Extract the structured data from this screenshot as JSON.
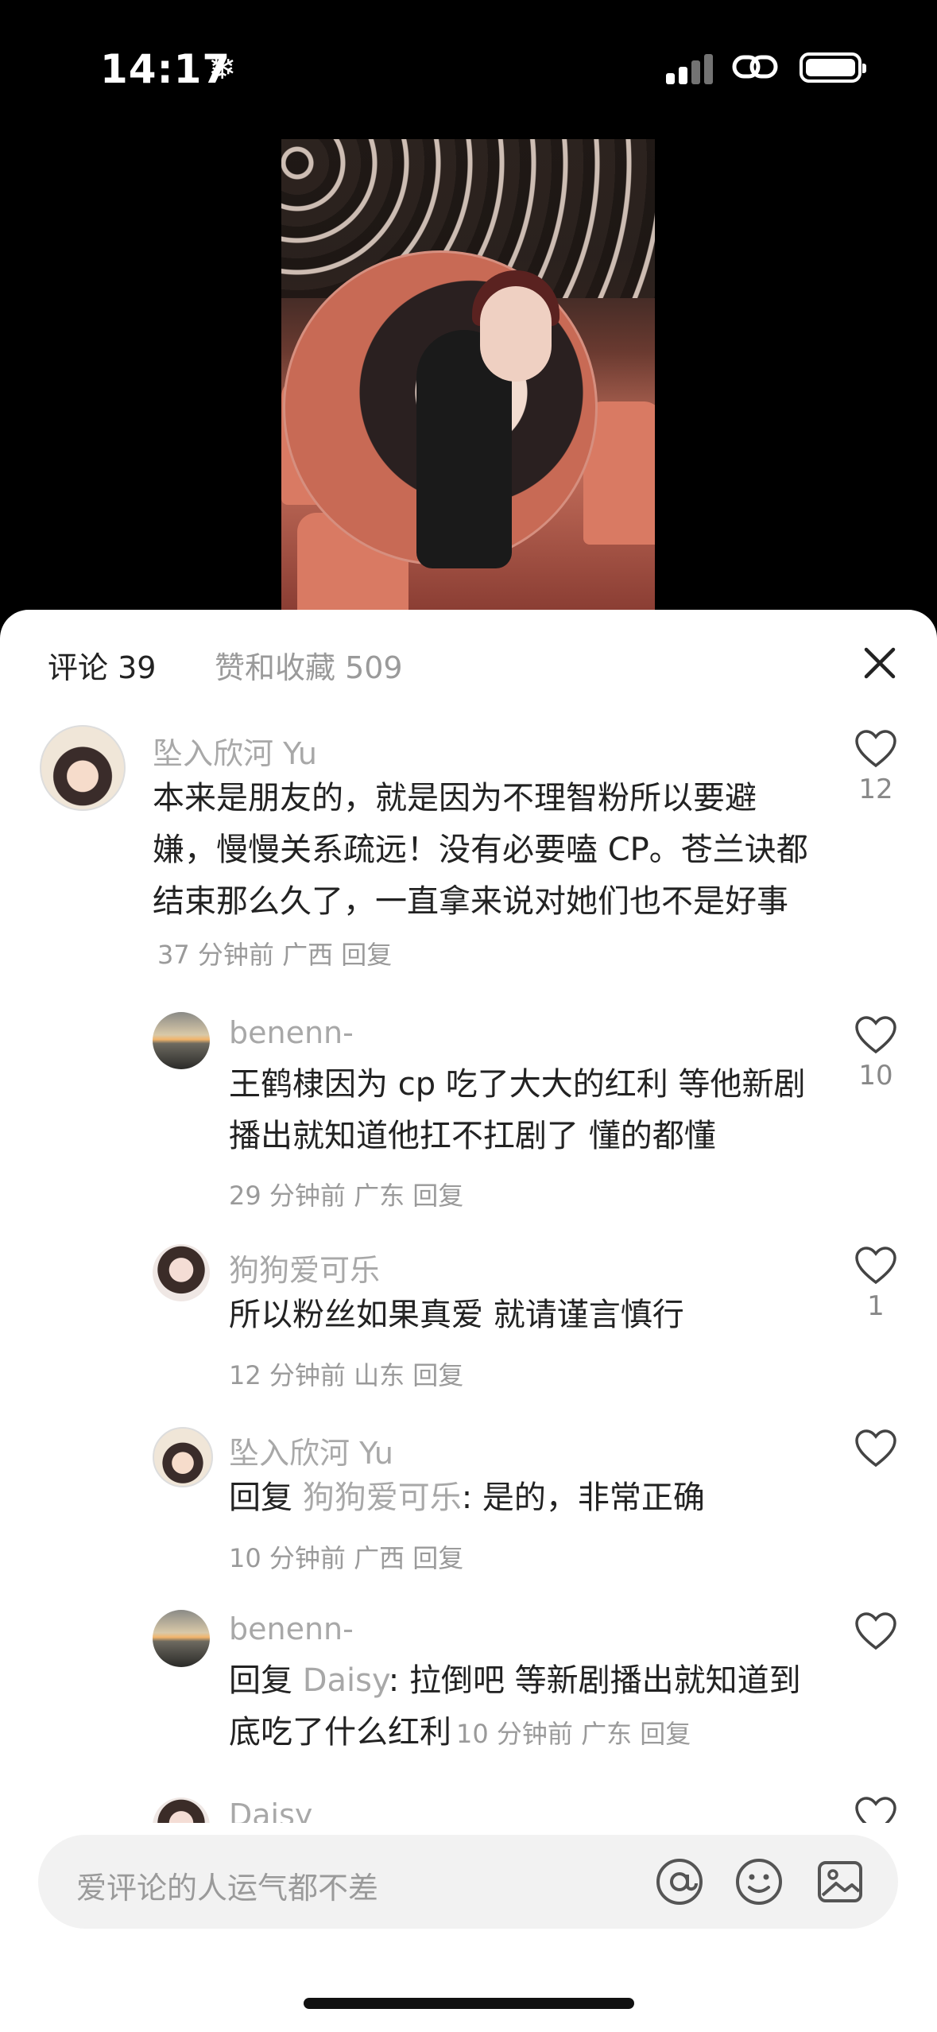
{
  "status_bar": {
    "time": "14:17",
    "snow": "❄"
  },
  "sheet": {
    "tab_comments": "评论 39",
    "tab_likes": "赞和收藏 509"
  },
  "comments": [
    {
      "user": "坠入欣河 Yu",
      "text": "本来是朋友的，就是因为不理智粉所以要避嫌，慢慢关系疏远！没有必要嗑 CP。苍兰诀都结束那么久了，一直拿来说对她们也不是好事",
      "meta": "37 分钟前  广西  回复",
      "likes": "12"
    },
    {
      "user": "benenn-",
      "text": "王鹤棣因为 cp 吃了大大的红利  等他新剧播出就知道他扛不扛剧了  懂的都懂",
      "meta": "29 分钟前  广东  回复",
      "likes": "10"
    },
    {
      "user": "狗狗爱可乐",
      "text": "所以粉丝如果真爱 就请谨言慎行",
      "meta": "12 分钟前  山东  回复",
      "likes": "1"
    },
    {
      "user": "坠入欣河 Yu",
      "reply_prefix": "回复",
      "reply_to": "狗狗爱可乐",
      "text": ": 是的，非常正确",
      "meta": "10 分钟前  广西  回复",
      "likes": ""
    },
    {
      "user": "benenn-",
      "reply_prefix": "回复",
      "reply_to": "Daisy",
      "text": ": 拉倒吧 等新剧播出就知道到底吃了什么红利",
      "meta": "10 分钟前  广东  回复",
      "likes": ""
    },
    {
      "user": "Daisy"
    }
  ],
  "input": {
    "placeholder": "爱评论的人运气都不差"
  }
}
